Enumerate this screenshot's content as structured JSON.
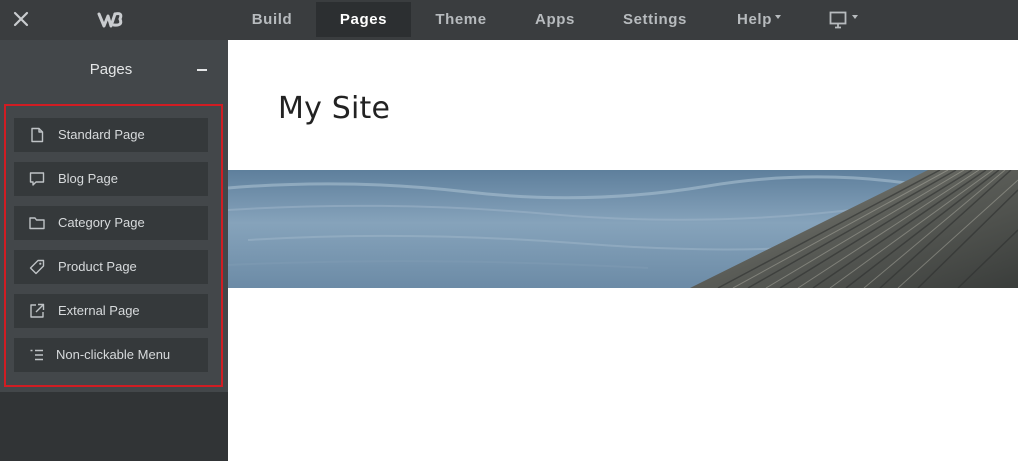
{
  "topbar": {
    "close_icon": "close-icon",
    "logo_icon": "weebly-logo-icon",
    "nav": [
      {
        "label": "Build",
        "active": false
      },
      {
        "label": "Pages",
        "active": true
      },
      {
        "label": "Theme",
        "active": false
      },
      {
        "label": "Apps",
        "active": false
      },
      {
        "label": "Settings",
        "active": false
      },
      {
        "label": "Help",
        "active": false,
        "dropdown": true
      }
    ],
    "device_icon": "monitor-icon"
  },
  "sidebar": {
    "title": "Pages",
    "collapse_icon": "minus-icon",
    "page_types": [
      {
        "label": "Standard Page",
        "icon": "document-icon"
      },
      {
        "label": "Blog Page",
        "icon": "comment-icon"
      },
      {
        "label": "Category Page",
        "icon": "folder-icon"
      },
      {
        "label": "Product Page",
        "icon": "tag-icon"
      },
      {
        "label": "External Page",
        "icon": "external-link-icon"
      },
      {
        "label": "Non-clickable Menu",
        "icon": "list-icon"
      }
    ]
  },
  "site": {
    "title": "My Site"
  },
  "colors": {
    "topbar_bg": "#3a3d3f",
    "sidebar_bg": "#43474a",
    "highlight": "#d11d23",
    "nav_text": "#b7bbbe"
  }
}
